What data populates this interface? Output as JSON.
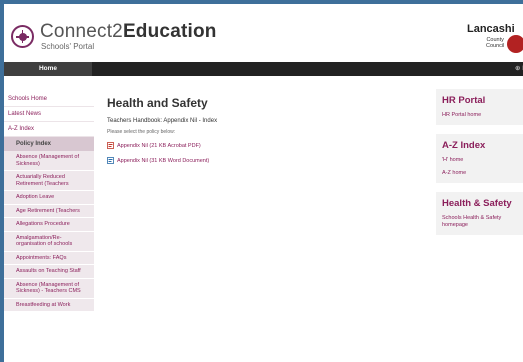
{
  "header": {
    "brand_light": "Connect2",
    "brand_bold": "Education",
    "tagline": "Schools' Portal",
    "council_name": "Lancashi",
    "council_sub1": "County",
    "council_sub2": "Council"
  },
  "nav": {
    "home": "Home",
    "right": "⊕ Lo"
  },
  "sidebar": {
    "top_items": [
      "Schools Home",
      "Latest News",
      "A-Z Index"
    ],
    "section": "Policy Index",
    "sub_items": [
      "Absence (Management of Sickness)",
      "Actuarially Reduced Retirement (Teachers",
      "Adoption Leave",
      "Age Retirement (Teachers",
      "Allegations Procedure",
      "Amalgamation/Re-organisation of schools",
      "Appointments: FAQs",
      "Assaults on Teaching Staff",
      "Absence (Management of Sickness) - Teachers CMS",
      "Breastfeeding at Work"
    ]
  },
  "main": {
    "title": "Health and Safety",
    "subtitle": "Teachers Handbook: Appendix Nil - Index",
    "hint": "Please select the policy below:",
    "docs": [
      {
        "label": "Appendix Nil (21 KB Acrobat PDF)",
        "type": "pdf"
      },
      {
        "label": "Appendix Nil (31 KB Word Document)",
        "type": "word"
      }
    ]
  },
  "right": {
    "boxes": [
      {
        "title": "HR Portal",
        "links": [
          "HR Portal home"
        ]
      },
      {
        "title": "A-Z Index",
        "links": [
          "'H' home",
          "A-Z home"
        ]
      },
      {
        "title": "Health & Safety",
        "links": [
          "Schools Health & Safety homepage"
        ]
      }
    ]
  }
}
